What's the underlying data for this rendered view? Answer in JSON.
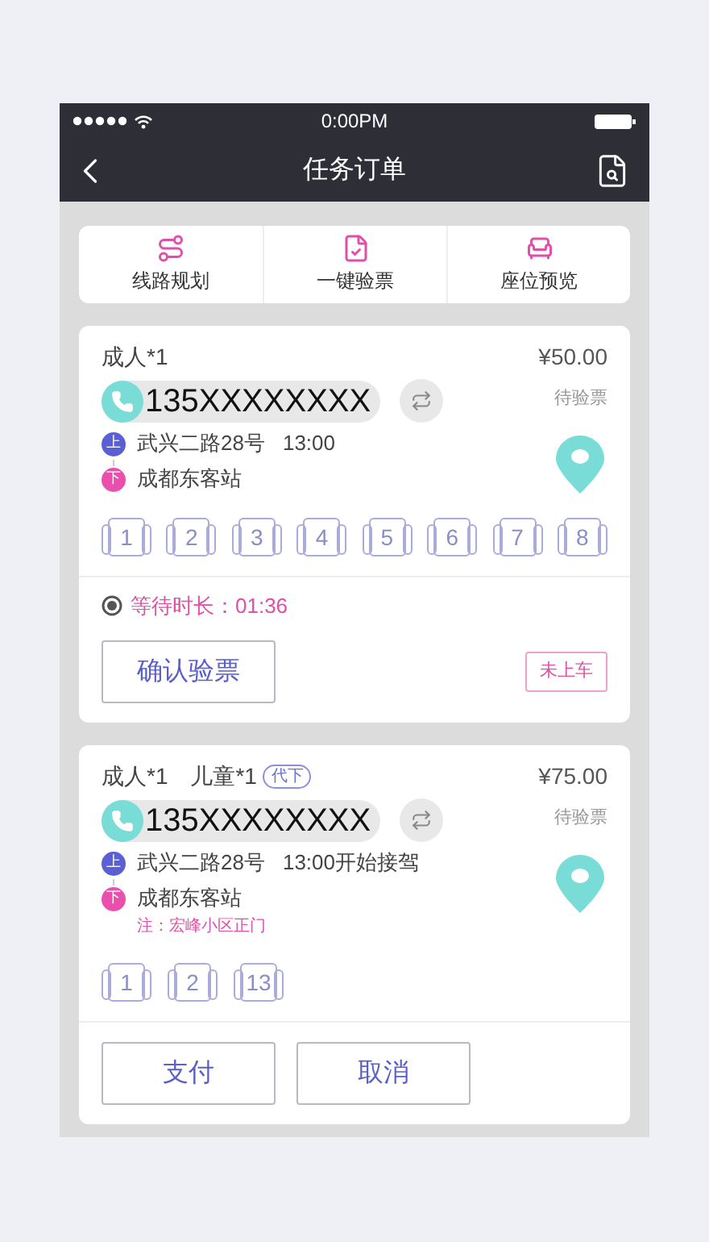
{
  "status_bar": {
    "time": "0:00PM"
  },
  "nav": {
    "title": "任务订单"
  },
  "toolbar": [
    {
      "label": "线路规划",
      "kind": "route"
    },
    {
      "label": "一键验票",
      "kind": "ticket"
    },
    {
      "label": "座位预览",
      "kind": "seat"
    }
  ],
  "orders": [
    {
      "passengers": "成人*1",
      "price": "¥50.00",
      "phone": "135XXXXXXXX",
      "status": "待验票",
      "pickup": {
        "badge": "上",
        "color": "#5a5fd3",
        "address": "武兴二路28号",
        "time": "13:00"
      },
      "dropoff": {
        "badge": "下",
        "color": "#ea4fae",
        "place": "成都东客站"
      },
      "seats": [
        "1",
        "2",
        "3",
        "4",
        "5",
        "6",
        "7",
        "8"
      ],
      "wait": "等待时长：01:36",
      "buttons": [
        "确认验票"
      ],
      "boarding": "未上车"
    },
    {
      "passengers": "成人*1",
      "child": "儿童*1",
      "tag": "代下",
      "price": "¥75.00",
      "phone": "135XXXXXXXX",
      "status": "待验票",
      "pickup": {
        "badge": "上",
        "color": "#5a5fd3",
        "address": "武兴二路28号",
        "time": "13:00开始接驾"
      },
      "dropoff": {
        "badge": "下",
        "color": "#ea4fae",
        "place": "成都东客站"
      },
      "note": "注：宏峰小区正门",
      "seats": [
        "1",
        "2",
        "13"
      ],
      "buttons": [
        "支付",
        "取消"
      ]
    }
  ]
}
